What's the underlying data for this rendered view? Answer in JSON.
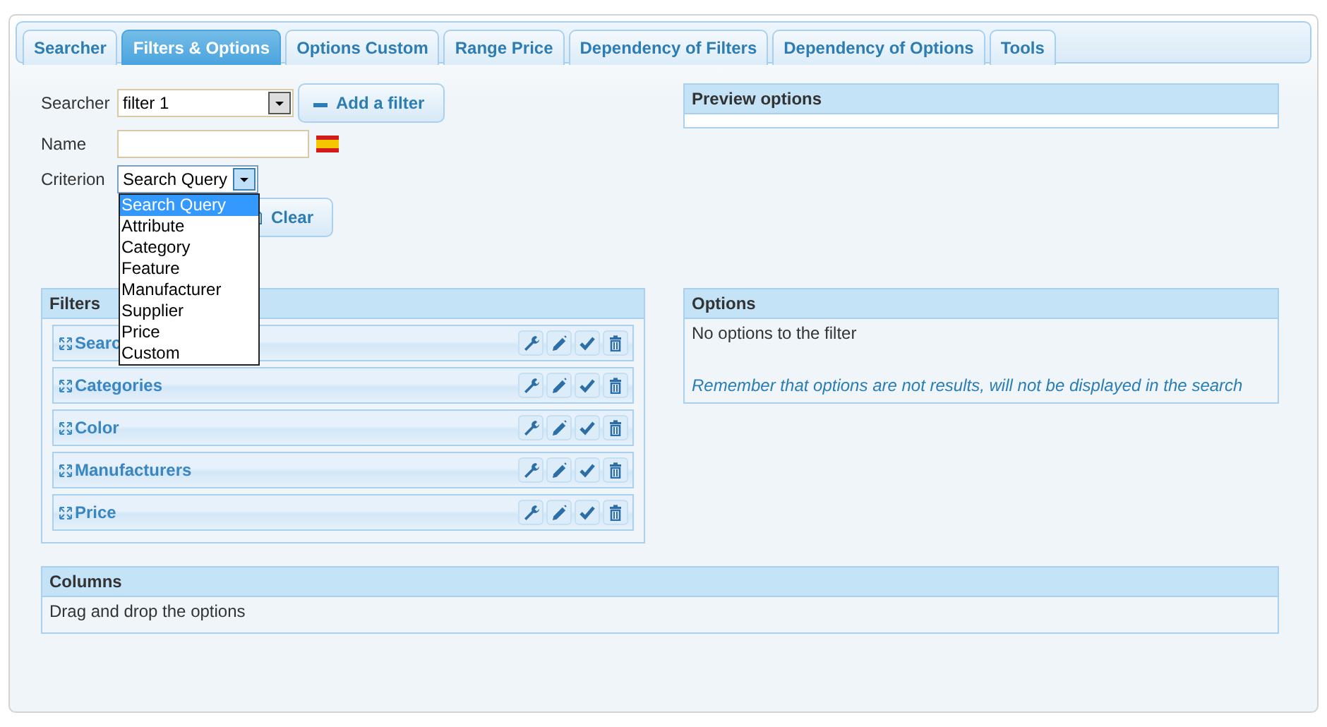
{
  "tabs": [
    {
      "label": "Searcher",
      "selected": false
    },
    {
      "label": "Filters & Options",
      "selected": true
    },
    {
      "label": "Options Custom",
      "selected": false
    },
    {
      "label": "Range Price",
      "selected": false
    },
    {
      "label": "Dependency of Filters",
      "selected": false
    },
    {
      "label": "Dependency of Options",
      "selected": false
    },
    {
      "label": "Tools",
      "selected": false
    }
  ],
  "form": {
    "searcher": {
      "label": "Searcher",
      "value": "filter 1"
    },
    "add_button": "Add a filter",
    "name": {
      "label": "Name"
    },
    "criterion": {
      "label": "Criterion",
      "value": "Search Query",
      "expanded": true,
      "options": [
        {
          "label": "Search Query",
          "selected": true
        },
        {
          "label": "Attribute",
          "selected": false
        },
        {
          "label": "Category",
          "selected": false
        },
        {
          "label": "Feature",
          "selected": false
        },
        {
          "label": "Manufacturer",
          "selected": false
        },
        {
          "label": "Supplier",
          "selected": false
        },
        {
          "label": "Price",
          "selected": false
        },
        {
          "label": "Custom",
          "selected": false
        }
      ]
    },
    "clear_button": "Clear"
  },
  "preview_options": {
    "title": "Preview options"
  },
  "filters": {
    "title": "Filters",
    "items": [
      {
        "label": "Searc"
      },
      {
        "label": "Categories"
      },
      {
        "label": "Color"
      },
      {
        "label": "Manufacturers"
      },
      {
        "label": "Price"
      }
    ]
  },
  "options": {
    "title": "Options",
    "message": "No options to the filter",
    "note": "Remember that options are not results, will not be displayed in the search"
  },
  "columns": {
    "title": "Columns",
    "message": "Drag and drop the options"
  }
}
